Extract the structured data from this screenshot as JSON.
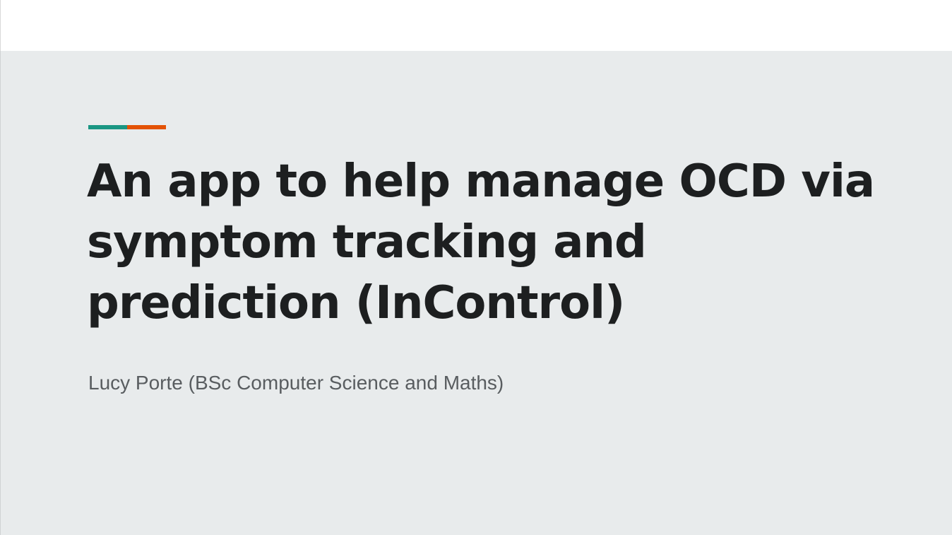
{
  "slide": {
    "title_lines": [
      "An app to help manage OCD via",
      "symptom tracking and",
      "prediction (InControl)"
    ],
    "subtitle": "Lucy Porte (BSc Computer Science and Maths)"
  },
  "colors": {
    "accent_teal": "#1a9683",
    "accent_orange": "#e35205",
    "title_text": "#1d1f20",
    "subtitle_text": "#595d60",
    "slide_background": "#e8ebec"
  }
}
